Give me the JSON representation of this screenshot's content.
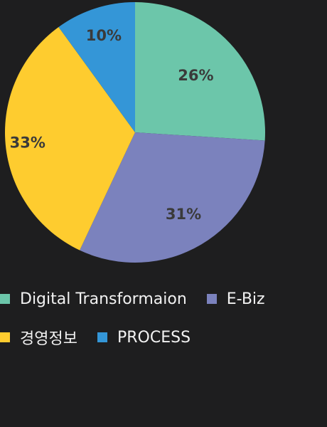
{
  "chart_data": {
    "type": "pie",
    "title": "",
    "categories": [
      "Digital Transformaion",
      "E-Biz",
      "경영정보",
      "PROCESS"
    ],
    "values": [
      26,
      31,
      33,
      10
    ],
    "labels": [
      "26%",
      "31%",
      "33%",
      "10%"
    ],
    "colors": [
      "#6cc6aa",
      "#7b82bd",
      "#fecc2f",
      "#3496d7"
    ],
    "legend_position": "bottom"
  },
  "legend": {
    "rows": [
      [
        {
          "label": "Digital Transformaion",
          "color": "#6cc6aa"
        },
        {
          "label": "E-Biz",
          "color": "#7b82bd"
        }
      ],
      [
        {
          "label": "경영정보",
          "color": "#fecc2f"
        },
        {
          "label": "PROCESS",
          "color": "#3496d7"
        }
      ]
    ]
  }
}
